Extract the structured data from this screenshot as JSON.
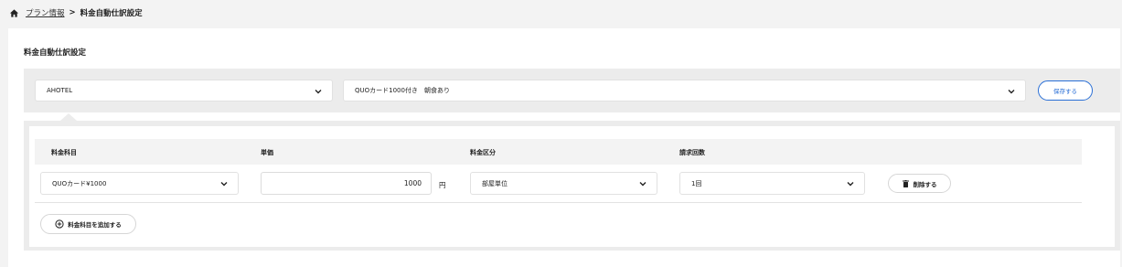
{
  "breadcrumb": {
    "link_label": "プラン情報",
    "separator": ">",
    "current": "料金自動仕訳設定"
  },
  "page": {
    "title": "料金自動仕訳設定"
  },
  "filters": {
    "hotel_value": "AHOTEL",
    "plan_value": "QUOカード1000付き　朝食あり",
    "save_label": "保存する"
  },
  "table": {
    "headers": [
      "料金科目",
      "単価",
      "料金区分",
      "請求回数"
    ],
    "rows": [
      {
        "item": "QUOカード¥1000",
        "unit_price": "1000",
        "currency": "円",
        "category": "部屋単位",
        "billing_count": "1回",
        "delete_label": "削除する"
      }
    ],
    "add_label": "料金科目を追加する"
  },
  "colors": {
    "accent": "#2a6fd6",
    "background": "#f3f3f3"
  },
  "icons": [
    "home-icon",
    "chevron-down-icon",
    "trash-icon",
    "plus-circle-icon"
  ]
}
